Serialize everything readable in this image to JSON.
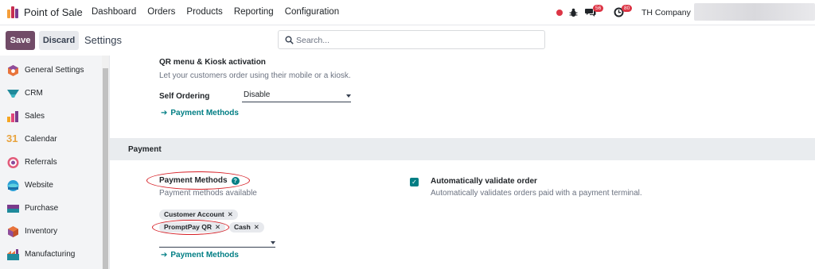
{
  "app": {
    "name": "Point of Sale",
    "menu": [
      "Dashboard",
      "Orders",
      "Products",
      "Reporting",
      "Configuration"
    ],
    "company": "TH Company",
    "messages_badge": "56",
    "activities_badge": "80"
  },
  "control": {
    "save_label": "Save",
    "discard_label": "Discard",
    "breadcrumb": "Settings",
    "search_placeholder": "Search..."
  },
  "sidebar": {
    "items": [
      {
        "label": "General Settings",
        "icon": "general-settings-icon"
      },
      {
        "label": "CRM",
        "icon": "crm-icon"
      },
      {
        "label": "Sales",
        "icon": "sales-icon"
      },
      {
        "label": "Calendar",
        "icon": "calendar-icon"
      },
      {
        "label": "Referrals",
        "icon": "referrals-icon"
      },
      {
        "label": "Website",
        "icon": "website-icon"
      },
      {
        "label": "Purchase",
        "icon": "purchase-icon"
      },
      {
        "label": "Inventory",
        "icon": "inventory-icon"
      },
      {
        "label": "Manufacturing",
        "icon": "manufacturing-icon"
      }
    ],
    "calendar_number": "31"
  },
  "self_order": {
    "title": "QR menu & Kiosk activation",
    "description": "Let your customers order using their mobile or a kiosk.",
    "field_label": "Self Ordering",
    "field_value": "Disable",
    "link_label": "Payment Methods"
  },
  "payment": {
    "section_title": "Payment",
    "methods_title": "Payment Methods",
    "methods_help": "?",
    "methods_description": "Payment methods available",
    "tags": [
      "Customer Account",
      "PromptPay QR",
      "Cash"
    ],
    "link_label": "Payment Methods",
    "auto_validate_title": "Automatically validate order",
    "auto_validate_description": "Automatically validates orders paid with a payment terminal.",
    "auto_validate_checked": true
  },
  "colors": {
    "brand": "#714b67",
    "accent": "#017e84",
    "highlight": "#d61f26"
  }
}
